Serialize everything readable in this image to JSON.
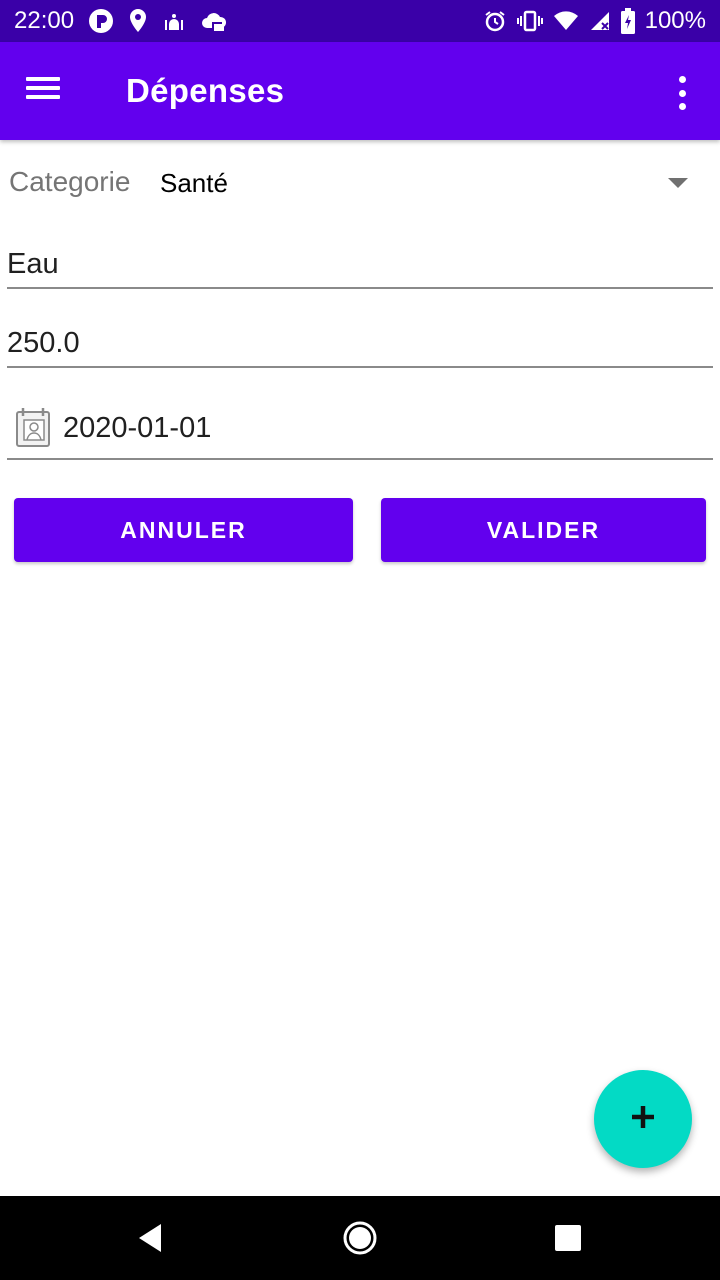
{
  "status_bar": {
    "time": "22:00",
    "battery": "100%",
    "left_icons": [
      "notification-app-icon",
      "location-icon",
      "mosque-icon",
      "cloud-icon"
    ],
    "right_icons": [
      "alarm-icon",
      "vibrate-icon",
      "wifi-icon",
      "signal-icon",
      "battery-icon"
    ]
  },
  "app_bar": {
    "title": "Dépenses",
    "background": "#6200ee"
  },
  "form": {
    "category_label": "Categorie",
    "category_value": "Santé",
    "name_value": "Eau",
    "amount_value": "250.0",
    "date_value": "2020-01-01"
  },
  "buttons": {
    "cancel_label": "ANNULER",
    "validate_label": "VALIDER"
  },
  "fab": {
    "icon": "plus-icon",
    "color": "#03dac5"
  },
  "nav_bar": {
    "icons": [
      "back-icon",
      "home-icon",
      "recents-icon"
    ]
  }
}
